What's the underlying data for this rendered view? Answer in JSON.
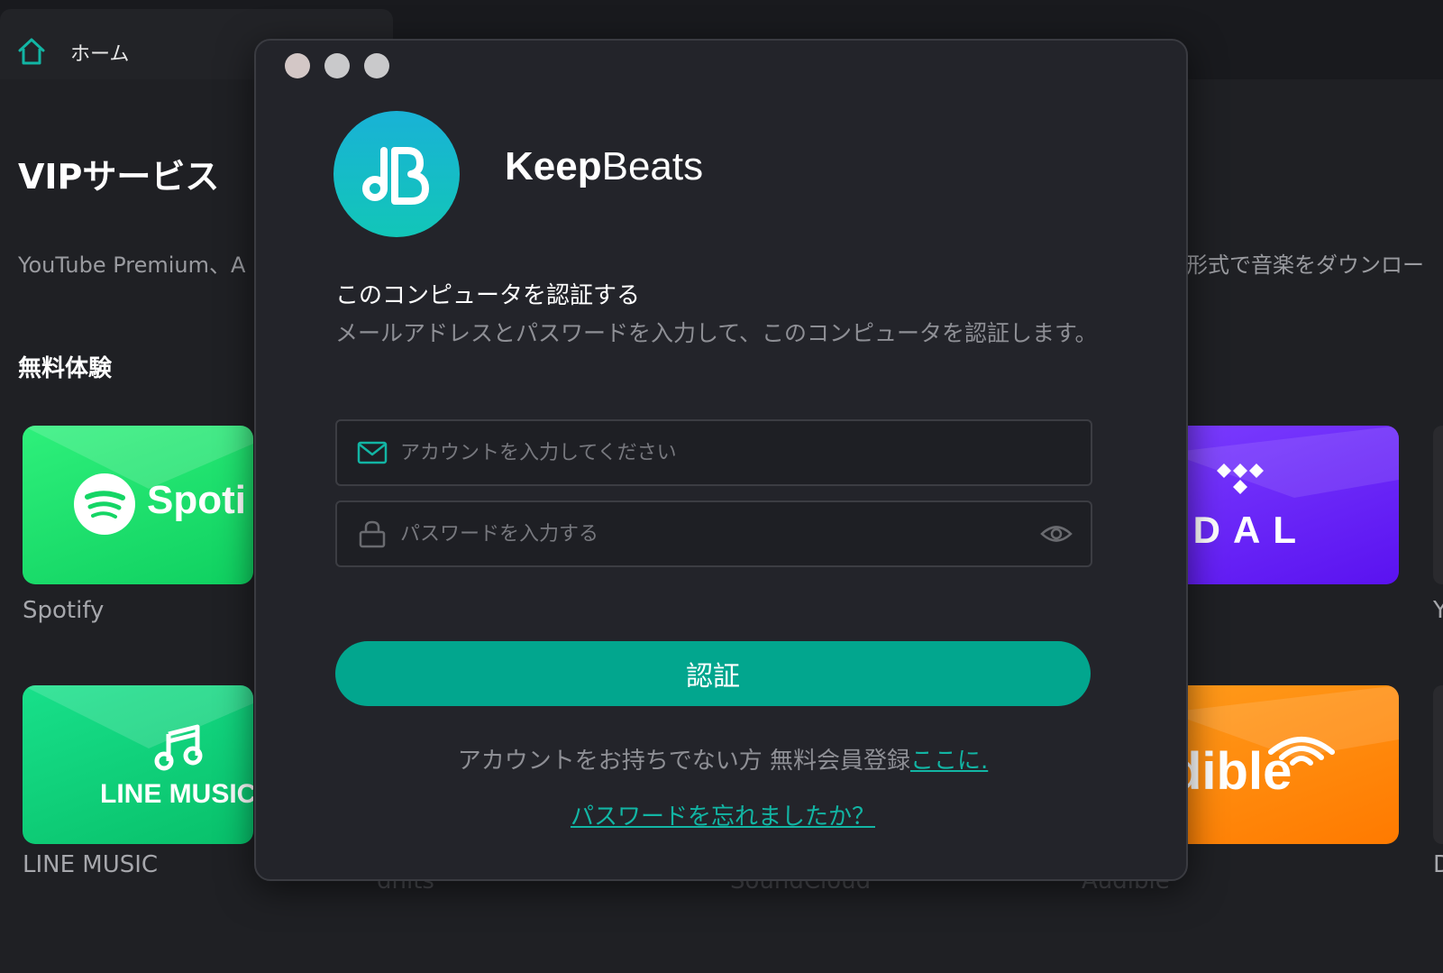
{
  "header": {
    "home_label": "ホーム"
  },
  "vip": {
    "title": "VIPサービス",
    "description_left": "YouTube Premium、A",
    "description_right": "形式で音楽をダウンロー"
  },
  "trial": {
    "title": "無料体験",
    "tiles": [
      {
        "name": "spotify",
        "logo_text": "Spoti",
        "label": "Spotify"
      },
      {
        "name": "line-music",
        "logo_text": "LINE MUSIC",
        "label": "LINE MUSIC"
      },
      {
        "name": "tidal",
        "logo_text": "IDAL",
        "label": ""
      },
      {
        "name": "audible",
        "logo_text": "dible",
        "label": "Audible"
      }
    ],
    "obscured_labels": {
      "a": "dnits",
      "b": "SoundCloud"
    },
    "edge_labels": {
      "top": "Y",
      "bottom": "D"
    }
  },
  "colors": {
    "accent": "#02a68e",
    "link": "#12b5a4",
    "spotify": "#1ed760",
    "tidal": "#6a20f8",
    "audible": "#ff8a00"
  },
  "modal": {
    "brand_bold": "Keep",
    "brand_light": "Beats",
    "title": "このコンピュータを認証する",
    "description": "メールアドレスとパスワードを入力して、このコンピュータを認証します。",
    "email_placeholder": "アカウントを入力してください",
    "password_placeholder": "パスワードを入力する",
    "submit_label": "認証",
    "signup_text": "アカウントをお持ちでない方 無料会員登録",
    "signup_link": "ここに.",
    "forgot_link": "パスワードを忘れましたか？"
  }
}
